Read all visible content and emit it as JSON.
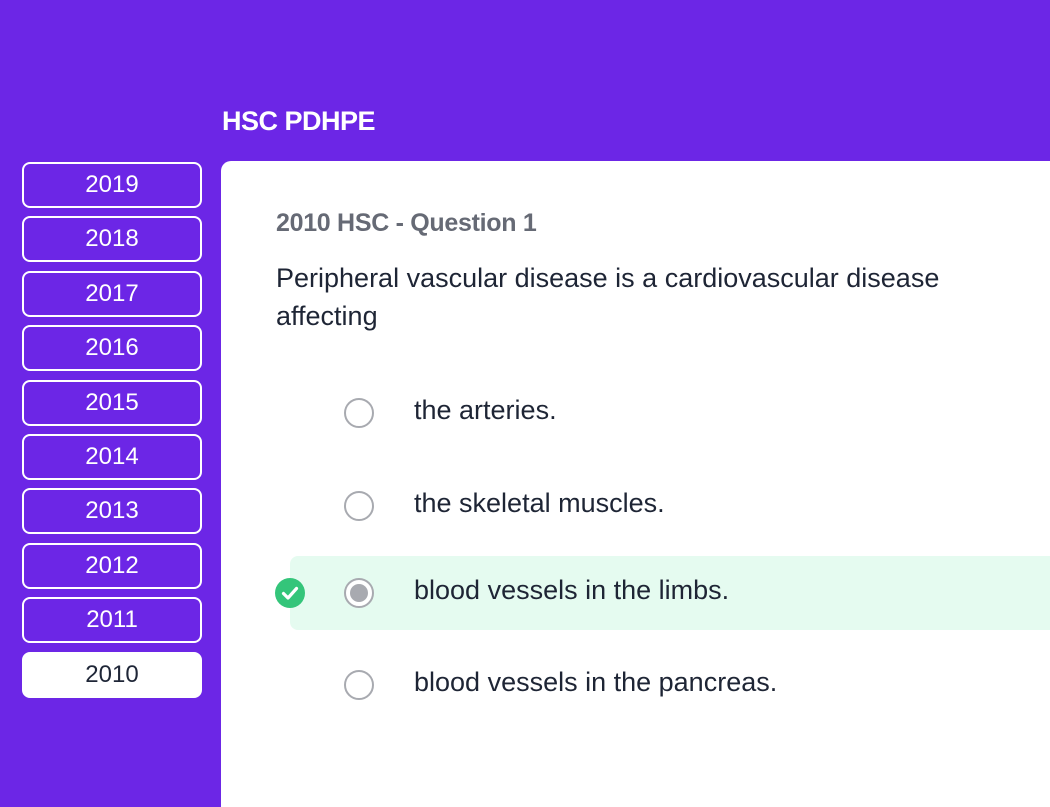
{
  "header": {
    "title": "HSC PDHPE"
  },
  "sidebar": {
    "years": [
      {
        "label": "2019",
        "active": false
      },
      {
        "label": "2018",
        "active": false
      },
      {
        "label": "2017",
        "active": false
      },
      {
        "label": "2016",
        "active": false
      },
      {
        "label": "2015",
        "active": false
      },
      {
        "label": "2014",
        "active": false
      },
      {
        "label": "2013",
        "active": false
      },
      {
        "label": "2012",
        "active": false
      },
      {
        "label": "2011",
        "active": false
      },
      {
        "label": "2010",
        "active": true
      }
    ]
  },
  "question": {
    "label": "2010 HSC - Question 1",
    "text": "Peripheral vascular disease is a cardiovascular disease affecting",
    "options": [
      {
        "text": "the arteries.",
        "selected": false,
        "correct": false
      },
      {
        "text": "the skeletal muscles.",
        "selected": false,
        "correct": false
      },
      {
        "text": "blood vessels in the limbs.",
        "selected": true,
        "correct": true
      },
      {
        "text": "blood vessels in the pancreas.",
        "selected": false,
        "correct": false
      }
    ],
    "correct_icon": "check-circle-icon"
  },
  "colors": {
    "background": "#6c26e6",
    "card": "#ffffff",
    "correct_highlight": "#e5fbf0",
    "correct_icon": "#34c57a",
    "radio": "#a8aab0",
    "text": "#1e2535",
    "label": "#666a75"
  }
}
